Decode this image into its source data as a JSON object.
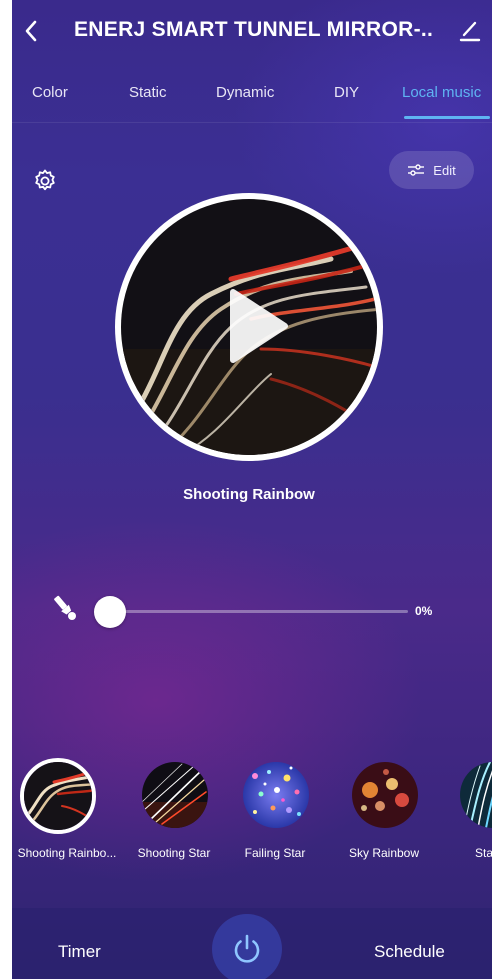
{
  "header": {
    "title": "ENERJ SMART TUNNEL MIRROR-..",
    "back_icon": "chevron-left-icon",
    "edit_icon": "pencil-icon"
  },
  "tabs": [
    {
      "label": "Color",
      "active": false
    },
    {
      "label": "Static",
      "active": false
    },
    {
      "label": "Dynamic",
      "active": false
    },
    {
      "label": "DIY",
      "active": false
    },
    {
      "label": "Local music",
      "active": true
    }
  ],
  "toolbar": {
    "settings_icon": "gear-icon",
    "edit_label": "Edit",
    "edit_icon": "sliders-icon"
  },
  "player": {
    "track_title": "Shooting Rainbow",
    "play_icon": "play-icon"
  },
  "brightness": {
    "icon": "flashlight-icon",
    "value_label": "0%",
    "level": 0
  },
  "scenes": [
    {
      "label": "Shooting Rainbo...",
      "selected": true
    },
    {
      "label": "Shooting Star",
      "selected": false
    },
    {
      "label": "Failing Star",
      "selected": false
    },
    {
      "label": "Sky Rainbow",
      "selected": false
    },
    {
      "label": "Star R",
      "selected": false
    }
  ],
  "bottom_bar": {
    "timer_label": "Timer",
    "schedule_label": "Schedule",
    "power_icon": "power-icon"
  },
  "colors": {
    "accent": "#5fb4f2",
    "background": "#3b2f93"
  }
}
